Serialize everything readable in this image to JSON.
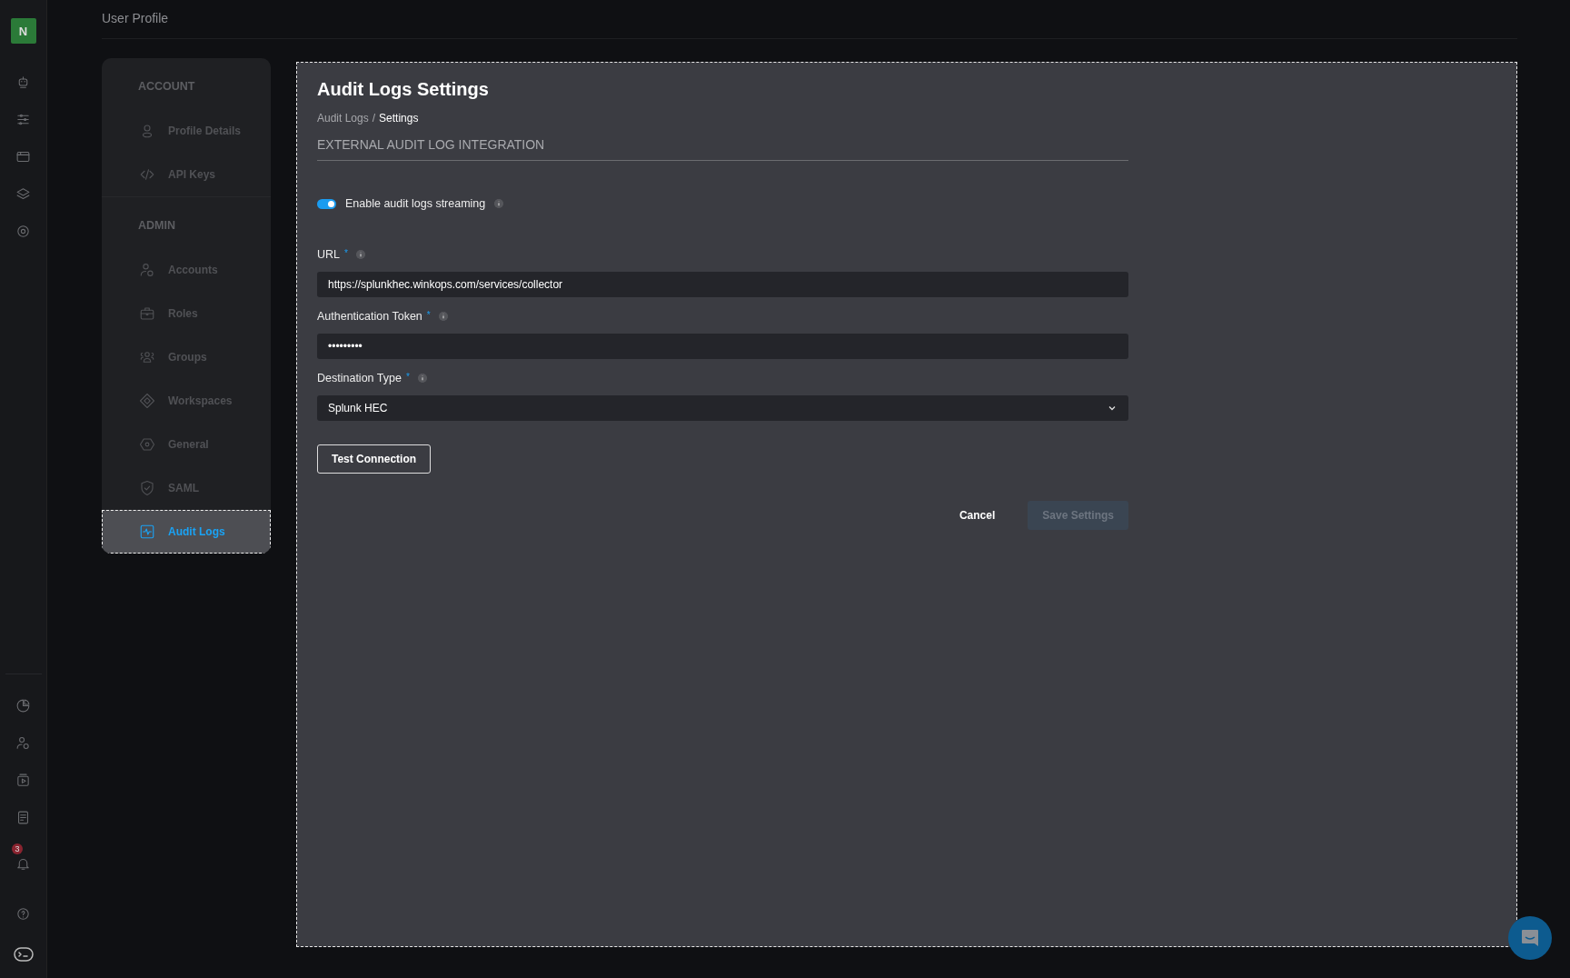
{
  "rail": {
    "avatar": "N",
    "top_icons": [
      {
        "kind": "robot"
      },
      {
        "kind": "sliders"
      },
      {
        "kind": "browser"
      },
      {
        "kind": "layers"
      },
      {
        "kind": "gear"
      }
    ],
    "bottom_icons": [
      {
        "kind": "pie"
      },
      {
        "kind": "user-gear"
      },
      {
        "kind": "play"
      },
      {
        "kind": "doc"
      },
      {
        "kind": "bell",
        "badge": "3"
      },
      {
        "kind": "help"
      },
      {
        "kind": "terminal"
      }
    ]
  },
  "header": {
    "title": "User Profile"
  },
  "sidebar": {
    "sections": [
      {
        "title": "ACCOUNT",
        "items": [
          {
            "label": "Profile Details",
            "kind": "user",
            "selected": false
          },
          {
            "label": "API Keys",
            "kind": "code",
            "selected": false
          }
        ]
      },
      {
        "title": "ADMIN",
        "items": [
          {
            "label": "Accounts",
            "kind": "user-gear",
            "selected": false
          },
          {
            "label": "Roles",
            "kind": "briefcase",
            "selected": false
          },
          {
            "label": "Groups",
            "kind": "group",
            "selected": false
          },
          {
            "label": "Workspaces",
            "kind": "diamond",
            "selected": false
          },
          {
            "label": "General",
            "kind": "hex",
            "selected": false
          },
          {
            "label": "SAML",
            "kind": "shield",
            "selected": false
          },
          {
            "label": "Audit Logs",
            "kind": "pulse",
            "selected": true
          }
        ]
      }
    ]
  },
  "panel": {
    "title": "Audit Logs Settings",
    "breadcrumb": [
      {
        "label": "Audit Logs",
        "current": false
      },
      {
        "label": "Settings",
        "current": true
      }
    ],
    "breadcrumb_separator": "/",
    "section_title": "EXTERNAL AUDIT LOG INTEGRATION",
    "toggle": {
      "label": "Enable audit logs streaming",
      "on": true
    },
    "fields": [
      {
        "kind": "text",
        "label": "URL",
        "required_mark": "*",
        "value": "https://splunkhec.winkops.com/services/collector"
      },
      {
        "kind": "text",
        "label": "Authentication Token",
        "required_mark": "*",
        "value": "•••••••••"
      },
      {
        "kind": "select",
        "label": "Destination Type",
        "required_mark": "*",
        "value": "Splunk HEC"
      }
    ],
    "test_button": "Test Connection",
    "cancel_button": "Cancel",
    "save_button": {
      "label": "Save Settings",
      "disabled": true
    }
  }
}
